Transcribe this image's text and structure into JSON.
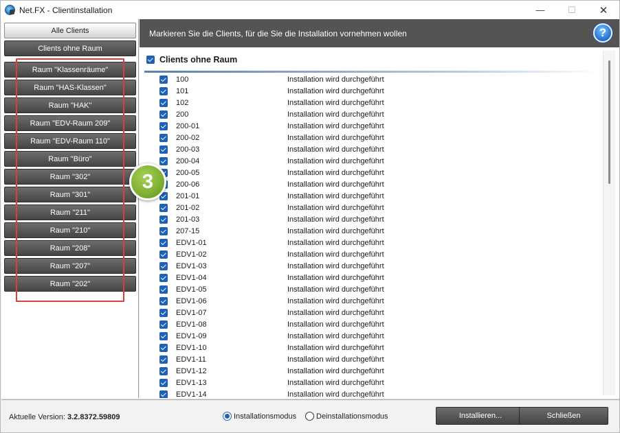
{
  "window": {
    "title": "Net.FX - Clientinstallation",
    "min_glyph": "—",
    "max_glyph": "☐",
    "close_glyph": "✕"
  },
  "sidebar": {
    "all_clients": "Alle Clients",
    "no_room": "Clients ohne Raum",
    "rooms": [
      "Raum \"Klassenräume\"",
      "Raum \"HAS-Klassen\"",
      "Raum \"HAK\"",
      "Raum \"EDV-Raum 209\"",
      "Raum \"EDV-Raum 110\"",
      "Raum \"Büro\"",
      "Raum \"302\"",
      "Raum \"301\"",
      "Raum \"211\"",
      "Raum \"210\"",
      "Raum \"208\"",
      "Raum \"207\"",
      "Raum \"202\""
    ]
  },
  "header": {
    "instruction": "Markieren Sie die Clients, für die Sie die Installation vornehmen wollen",
    "help_glyph": "?"
  },
  "group": {
    "title": "Clients ohne Raum"
  },
  "status_text": "Installation wird durchgeführt",
  "clients": [
    "100",
    "101",
    "102",
    "200",
    "200-01",
    "200-02",
    "200-03",
    "200-04",
    "200-05",
    "200-06",
    "201-01",
    "201-02",
    "201-03",
    "207-15",
    "EDV1-01",
    "EDV1-02",
    "EDV1-03",
    "EDV1-04",
    "EDV1-05",
    "EDV1-06",
    "EDV1-07",
    "EDV1-08",
    "EDV1-09",
    "EDV1-10",
    "EDV1-11",
    "EDV1-12",
    "EDV1-13",
    "EDV1-14"
  ],
  "step_badge": "3",
  "footer": {
    "version_label": "Aktuelle Version:",
    "version_value": "3.2.8372.59809",
    "radio_install": "Installationsmodus",
    "radio_uninstall": "Deinstallationsmodus",
    "install_button": "Installieren...",
    "close_button": "Schließen"
  },
  "colors": {
    "accent": "#1f62b5",
    "header_bg": "#545454",
    "highlight": "#e03c3c",
    "badge": "#7eaf32"
  }
}
